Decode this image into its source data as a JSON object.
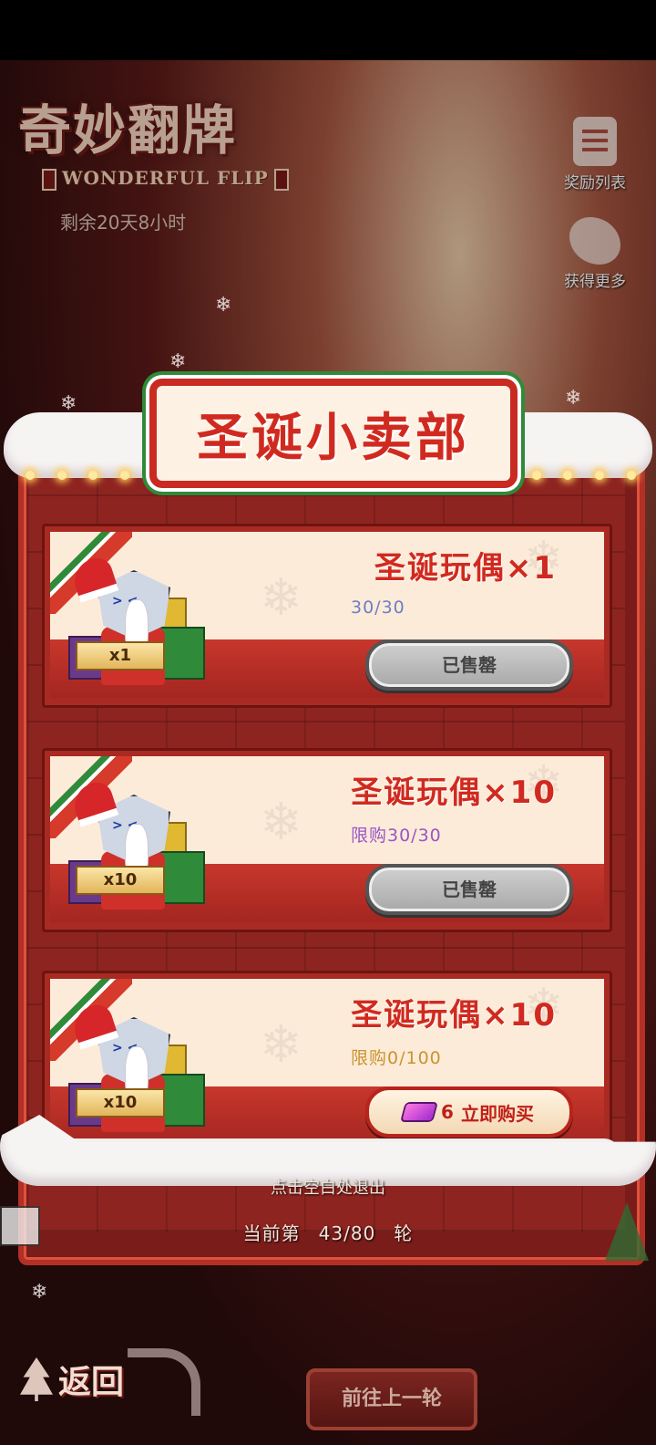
{
  "header": {
    "title": "奇妙翻牌",
    "subtitle": "WONDERFUL FLIP",
    "time_left": "剩余20天8小时"
  },
  "side_buttons": {
    "reward_list": "奖励列表",
    "get_more": "获得更多"
  },
  "shop": {
    "title": "圣诞小卖部",
    "items": [
      {
        "name": "圣诞玩偶×1",
        "quantity_label": "x1",
        "limit": "30/30",
        "limit_color": "#6d7fc2",
        "action": "已售罄",
        "state": "sold_out"
      },
      {
        "name": "圣诞玩偶×10",
        "quantity_label": "x10",
        "limit": "限购30/30",
        "limit_color": "#9a54c8",
        "action": "已售罄",
        "state": "sold_out"
      },
      {
        "name": "圣诞玩偶×10",
        "quantity_label": "x10",
        "limit": "限购0/100",
        "limit_color": "#c9942e",
        "action": "立即购买",
        "price": "6",
        "state": "available"
      }
    ]
  },
  "footer": {
    "exit_hint": "点击空白处退出",
    "round_prefix": "当前第",
    "round_value": "43/80",
    "round_suffix": "轮",
    "back_label": "返回",
    "prev_round": "前往上一轮"
  },
  "icons": [
    "document-icon",
    "leaf-icon",
    "gem-icon",
    "tree-icon",
    "snowflake-icon"
  ]
}
